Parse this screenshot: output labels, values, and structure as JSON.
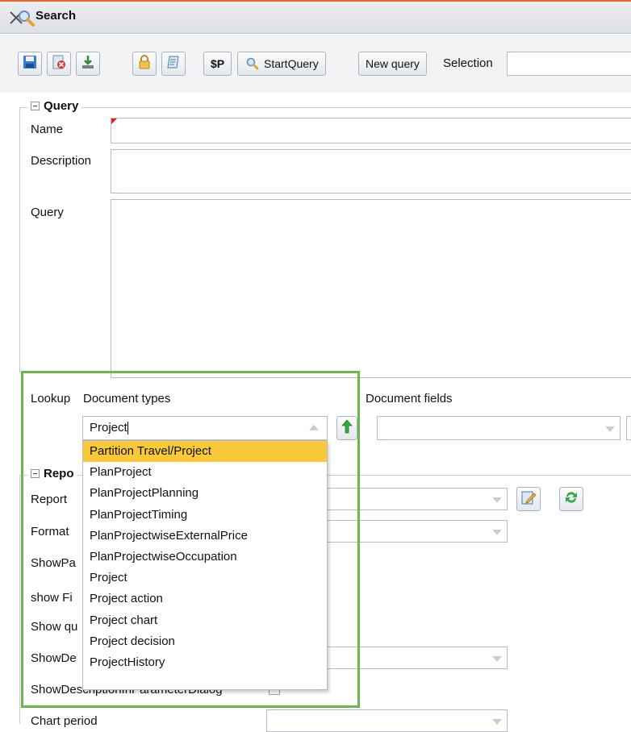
{
  "window": {
    "title": "Search"
  },
  "toolbar": {
    "dollar_p": "$P",
    "start_query": "StartQuery",
    "new_query": "New query",
    "selection_label": "Selection",
    "selection_value": ""
  },
  "query_section": {
    "legend": "Query",
    "name_label": "Name",
    "name_value": "",
    "description_label": "Description",
    "description_value": "",
    "query_label": "Query",
    "query_value": ""
  },
  "lookup": {
    "label": "Lookup",
    "doc_types_label": "Document types",
    "doc_types_value": "Project",
    "doc_fields_label": "Document fields",
    "doc_fields_value": "",
    "options": [
      "Partition Travel/Project",
      "PlanProject",
      "PlanProjectPlanning",
      "PlanProjectTiming",
      "PlanProjectwiseExternalPrice",
      "PlanProjectwiseOccupation",
      "Project",
      "Project action",
      "Project chart",
      "Project decision",
      "ProjectHistory"
    ],
    "selected_index": 0
  },
  "report_section": {
    "legend": "Repo",
    "report_label": "Report",
    "format_label": "Format",
    "showpa_label": "ShowPa",
    "show_fi_label": "show Fi",
    "show_qu_label": "Show qu",
    "showde_label": "ShowDe",
    "showdesc_label": "ShowDescriptionInParameterDialog",
    "chart_period_label": "Chart period"
  },
  "colors": {
    "highlight": "#f9c93b",
    "focus_box": "#6fb54f",
    "title_accent": "#e06b2a"
  }
}
